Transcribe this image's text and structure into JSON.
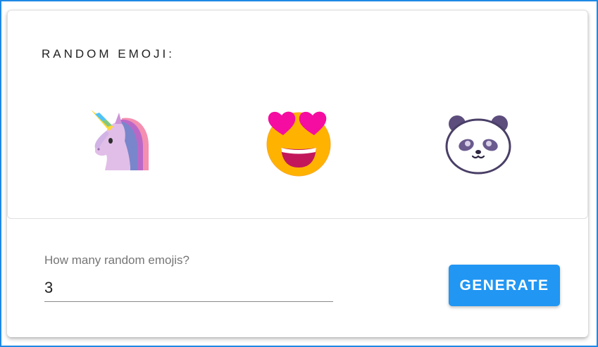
{
  "header": {
    "title": "RANDOM EMOJI:"
  },
  "emojis": [
    {
      "icon": "unicorn-icon"
    },
    {
      "icon": "heart-eyes-face-icon"
    },
    {
      "icon": "panda-face-icon"
    }
  ],
  "controls": {
    "count_label": "How many random emojis?",
    "count_value": "3",
    "generate_label": "GENERATE"
  },
  "colors": {
    "accent": "#2196f3",
    "frame_border": "#1e88e5"
  }
}
